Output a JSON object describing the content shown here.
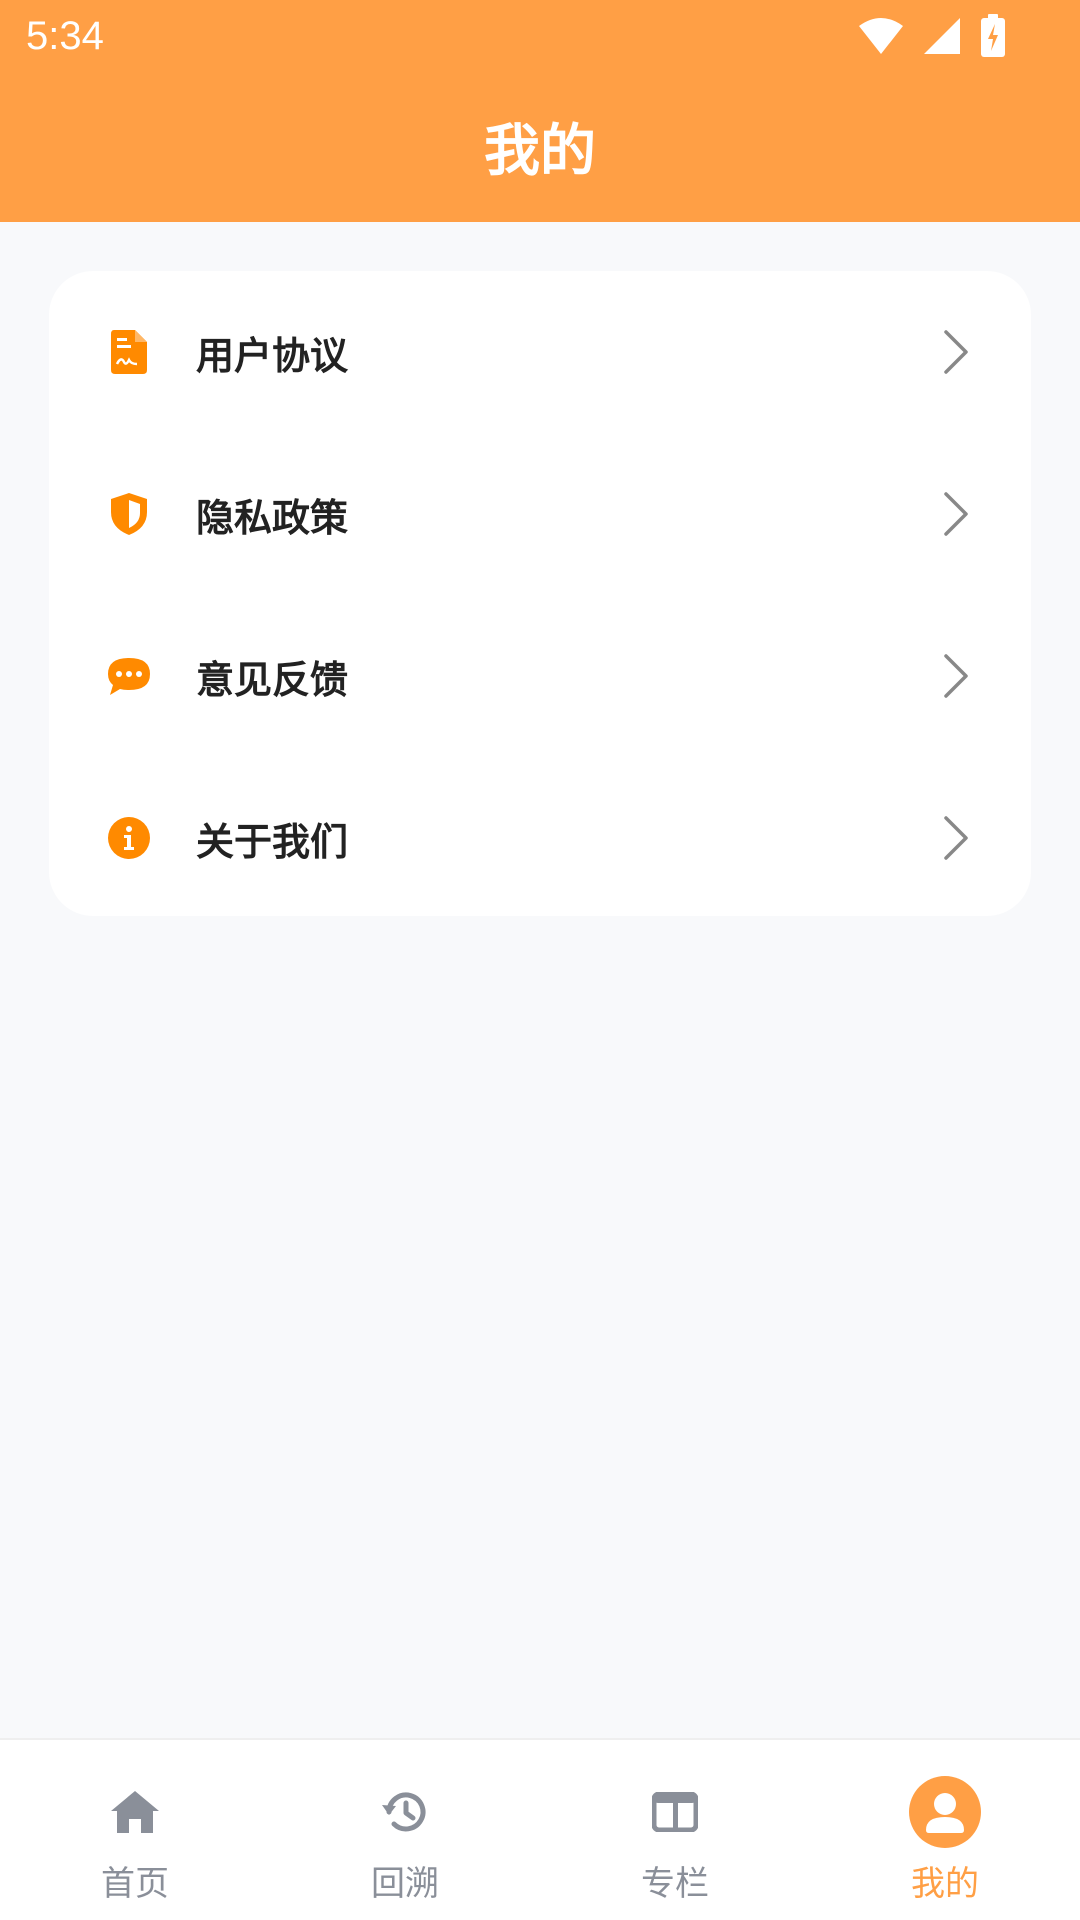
{
  "status_bar": {
    "time": "5:34"
  },
  "header": {
    "title": "我的"
  },
  "menu": {
    "items": [
      {
        "label": "用户协议",
        "icon": "document-icon"
      },
      {
        "label": "隐私政策",
        "icon": "shield-icon"
      },
      {
        "label": "意见反馈",
        "icon": "chat-bubble-icon"
      },
      {
        "label": "关于我们",
        "icon": "info-icon"
      }
    ]
  },
  "bottom_nav": {
    "items": [
      {
        "label": "首页",
        "icon": "home-icon",
        "active": false
      },
      {
        "label": "回溯",
        "icon": "history-icon",
        "active": false
      },
      {
        "label": "专栏",
        "icon": "columns-icon",
        "active": false
      },
      {
        "label": "我的",
        "icon": "user-icon",
        "active": true
      }
    ]
  },
  "colors": {
    "accent": "#FF9F45",
    "icon_orange": "#FF8A00",
    "nav_inactive": "#8A8F99",
    "background": "#F8F9FB"
  }
}
